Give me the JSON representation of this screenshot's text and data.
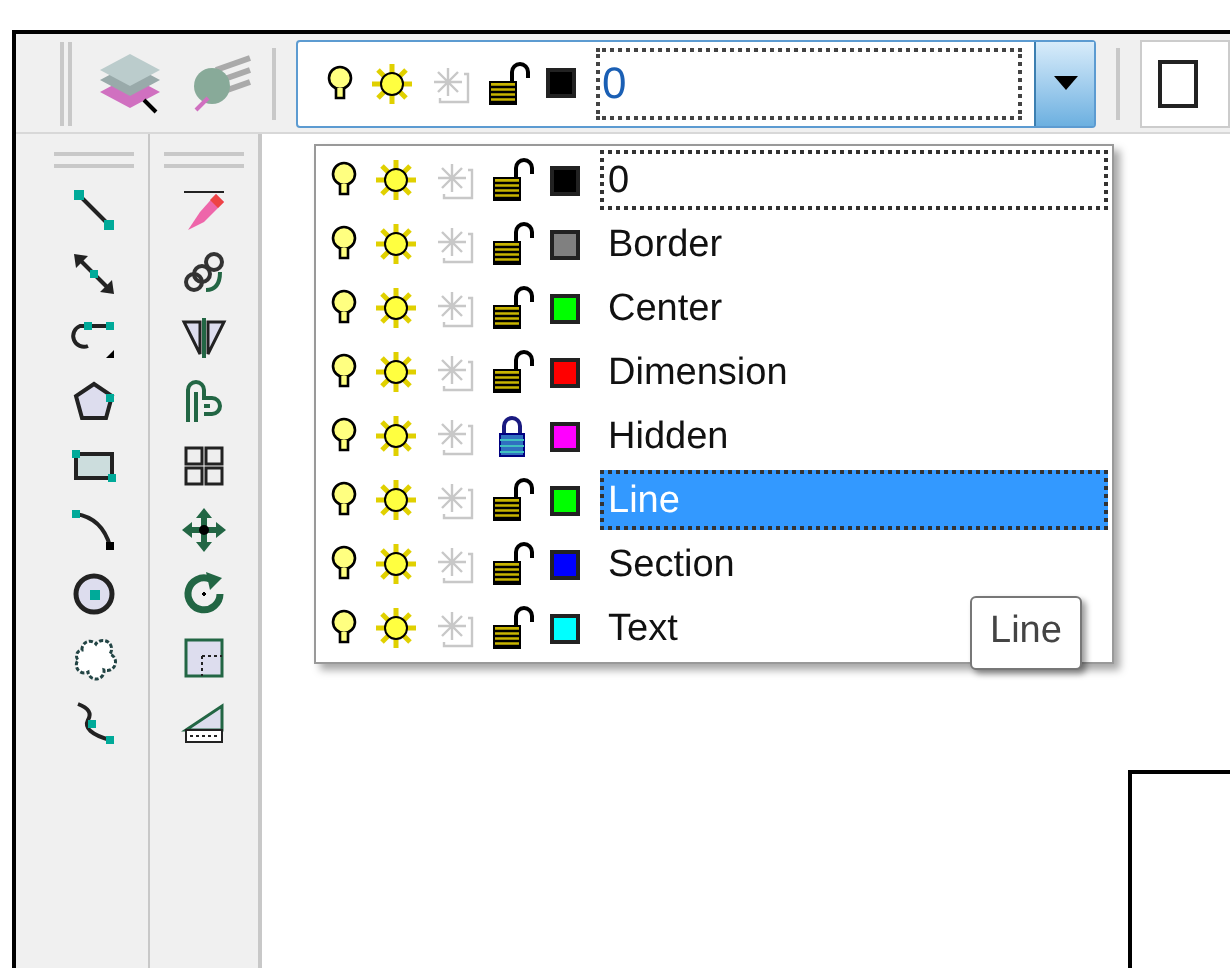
{
  "layer_combo": {
    "current": {
      "name": "0",
      "color": "#000000",
      "locked": false
    },
    "expanded": true
  },
  "layers": [
    {
      "name": "0",
      "color": "#000000",
      "locked": false,
      "selected": false,
      "focused": true
    },
    {
      "name": "Border",
      "color": "#808080",
      "locked": false,
      "selected": false,
      "focused": false
    },
    {
      "name": "Center",
      "color": "#00ff00",
      "locked": false,
      "selected": false,
      "focused": false
    },
    {
      "name": "Dimension",
      "color": "#ff0000",
      "locked": false,
      "selected": false,
      "focused": false
    },
    {
      "name": "Hidden",
      "color": "#ff00ff",
      "locked": true,
      "selected": false,
      "focused": false
    },
    {
      "name": "Line",
      "color": "#00ff00",
      "locked": false,
      "selected": true,
      "focused": false
    },
    {
      "name": "Section",
      "color": "#0000ff",
      "locked": false,
      "selected": false,
      "focused": false
    },
    {
      "name": "Text",
      "color": "#00ffff",
      "locked": false,
      "selected": false,
      "focused": false
    }
  ],
  "tooltip": {
    "text": "Line"
  }
}
